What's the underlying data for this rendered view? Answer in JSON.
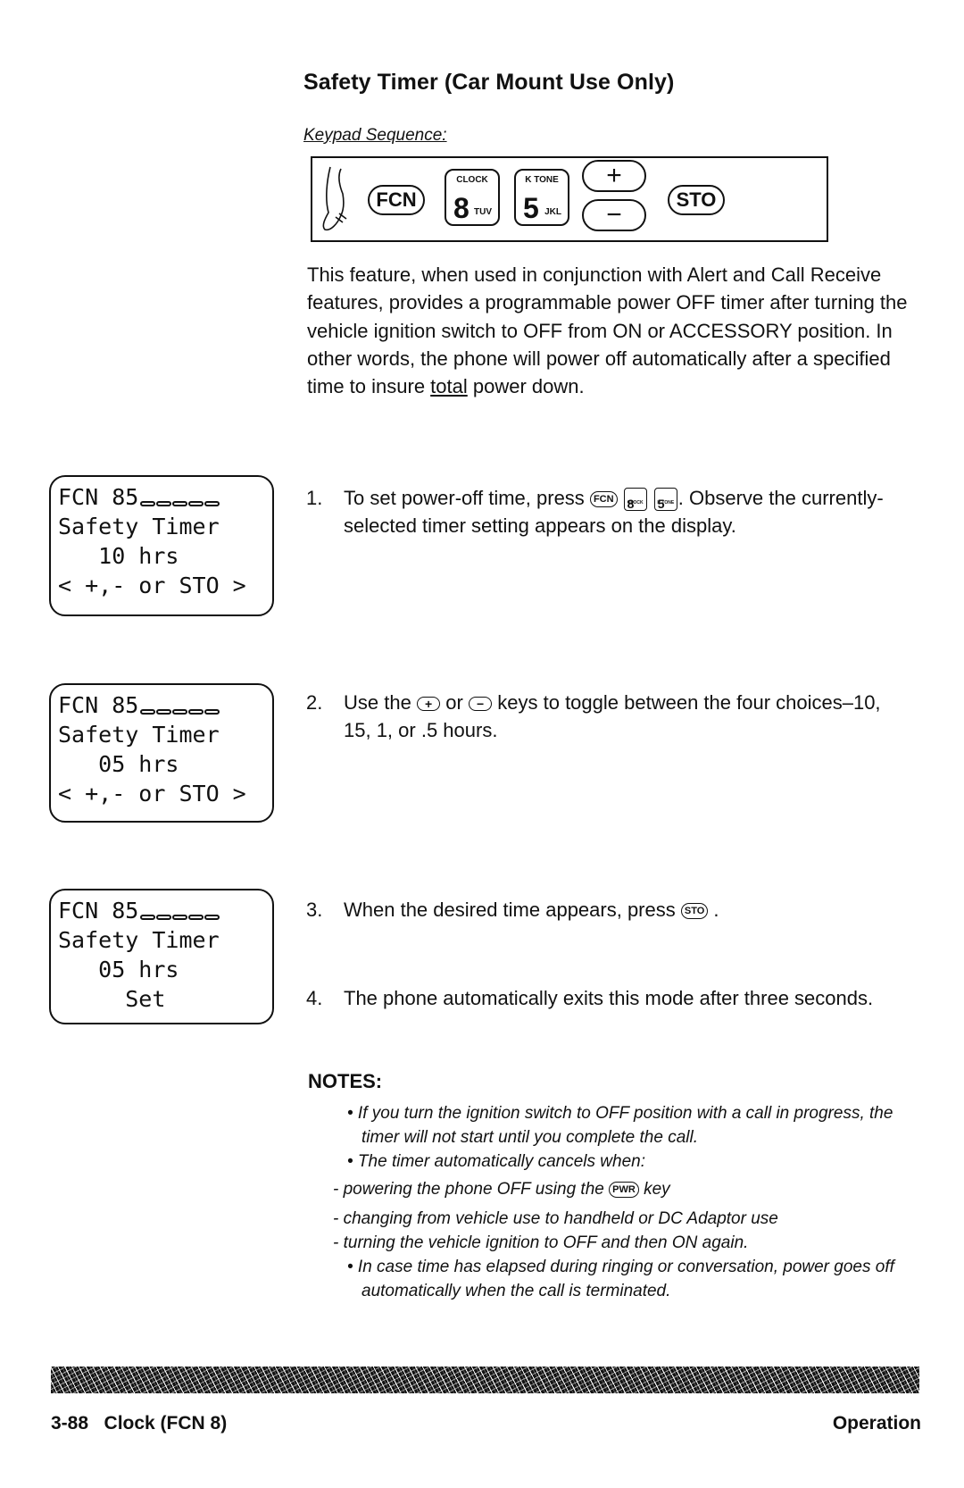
{
  "heading": "Safety Timer (Car Mount Use Only)",
  "keypad_sequence": {
    "label": "Keypad Sequence:",
    "keys": {
      "fcn": "FCN",
      "clock_key": {
        "top": "CLOCK",
        "num": "8",
        "sub": "TUV"
      },
      "ktone_key": {
        "top": "K TONE",
        "num": "5",
        "sub": "JKL"
      },
      "plus": "+",
      "minus": "−",
      "sto": "STO"
    }
  },
  "intro": {
    "text_before": "This feature, when used in conjunction with Alert and Call Receive features, provides a programmable power OFF timer after turning the vehicle ignition switch to OFF from ON or ACCESSORY position.  In other words, the phone will power off automatically after a specified time to insure ",
    "underlined": "total",
    "text_after": " power down."
  },
  "displays": [
    {
      "line1": "FCN 85",
      "line2": "Safety Timer",
      "line3": "   10 hrs",
      "line4": "< +,- or STO >"
    },
    {
      "line1": "FCN 85",
      "line2": "Safety Timer",
      "line3": "   05 hrs",
      "line4": "< +,- or STO >"
    },
    {
      "line1": "FCN 85",
      "line2": "Safety Timer",
      "line3": "   05 hrs",
      "line4": "     Set"
    }
  ],
  "steps": [
    {
      "num": "1.",
      "pre": "To set power-off time, press",
      "post": ".  Observe the currently-selected timer setting appears on the display."
    },
    {
      "num": "2.",
      "pre": "Use the",
      "mid": "or",
      "post": "keys to toggle between the four choices–10, 15, 1, or .5 hours."
    },
    {
      "num": "3.",
      "pre": "When the desired time appears, press",
      "post": "."
    },
    {
      "num": "4.",
      "text": "The phone automatically exits this mode after three seconds."
    }
  ],
  "notes": {
    "title": "NOTES:",
    "items": [
      "• If you turn the ignition switch to OFF position with a call in progress, the timer will not start until you complete the call.",
      "• The timer automatically cancels when:"
    ],
    "pwr_line_pre": "- powering the phone OFF using the",
    "pwr_key": "PWR",
    "pwr_line_post": "key",
    "dash_items": [
      "- changing from vehicle use to handheld or DC Adaptor use",
      "- turning the vehicle ignition to OFF and then ON again."
    ],
    "last": "• In case time has elapsed during ringing or conversation, power goes off automatically when the call is terminated."
  },
  "footer": {
    "left": "3-88   Clock (FCN 8)",
    "right": "Operation"
  }
}
